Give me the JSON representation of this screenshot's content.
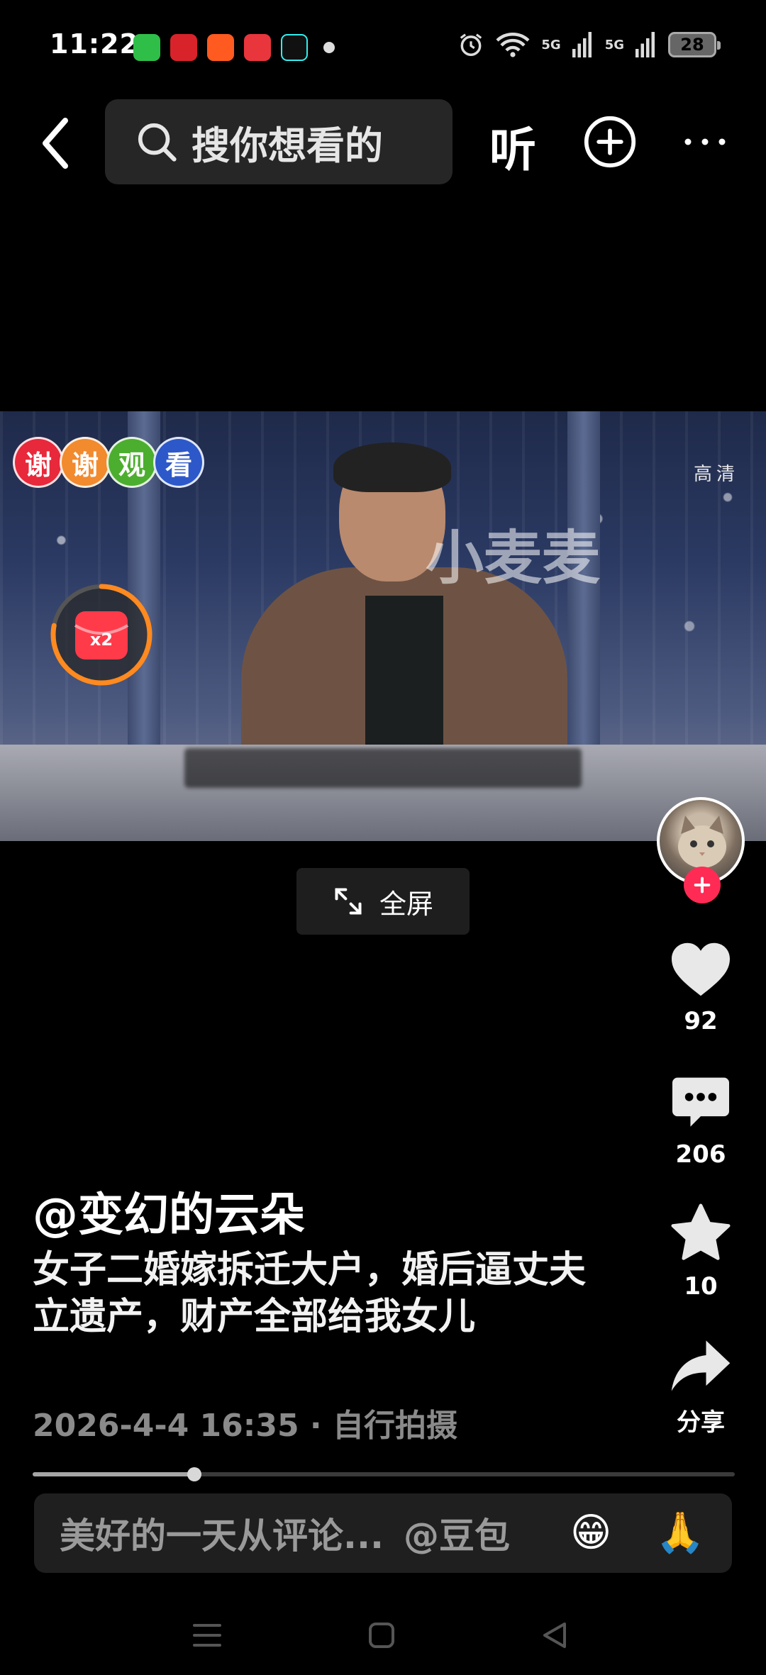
{
  "status_bar": {
    "time": "11:22",
    "app_icons": [
      {
        "name": "wechat-icon",
        "color": "#2fbf49"
      },
      {
        "name": "app-hearts-icon",
        "color": "#d8232a"
      },
      {
        "name": "taobao-icon",
        "color": "#ff5a1f"
      },
      {
        "name": "video-app-icon",
        "color": "#e8363c"
      },
      {
        "name": "tiktok-icon",
        "color": "#111111"
      }
    ],
    "network_1": "5G",
    "network_2": "5G",
    "battery": "28"
  },
  "top_bar": {
    "search_placeholder": "搜你想看的",
    "listen_label": "听"
  },
  "video": {
    "quality_label": "高清",
    "watermark": "小麦麦",
    "badges": [
      {
        "char": "谢",
        "color": "#e8283b"
      },
      {
        "char": "谢",
        "color": "#f28a2e"
      },
      {
        "char": "观",
        "color": "#4cae2e"
      },
      {
        "char": "看",
        "color": "#2d58c9"
      }
    ],
    "reward_label": "x2",
    "reward_progress": 0.78
  },
  "fullscreen_label": "全屏",
  "rail": {
    "likes": "92",
    "comments": "206",
    "favorites": "10",
    "share_label": "分享"
  },
  "post": {
    "author": "@变幻的云朵",
    "caption": "女子二婚嫁拆迁大户，婚后逼丈夫立遗产，财产全部给我女儿",
    "meta": "2026-4-4 16:35 · 自行拍摄"
  },
  "playback_progress": 0.23,
  "comment_bar": {
    "placeholder": "美好的一天从评论...",
    "mention": "@豆包",
    "emoji_1": "😁",
    "emoji_2": "🙏"
  }
}
